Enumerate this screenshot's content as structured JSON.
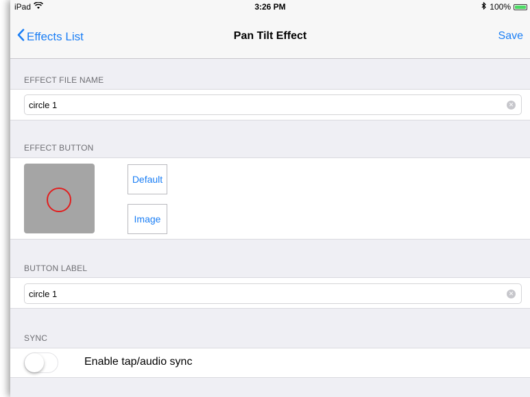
{
  "status_bar": {
    "device": "iPad",
    "time": "3:26 PM",
    "battery": "100%",
    "battery_level": 1.0
  },
  "nav": {
    "back_label": "Effects List",
    "title": "Pan Tilt Effect",
    "save_label": "Save"
  },
  "sections": {
    "file_name": {
      "header": "EFFECT FILE NAME",
      "value": "circle 1"
    },
    "effect_button": {
      "header": "EFFECT BUTTON",
      "default_label": "Default",
      "image_label": "Image"
    },
    "button_label": {
      "header": "BUTTON LABEL",
      "value": "circle 1"
    },
    "sync": {
      "header": "SYNC",
      "toggle_label": "Enable tap/audio sync",
      "enabled": false
    }
  },
  "colors": {
    "accent": "#1a7ef5",
    "background": "#efeff4",
    "preview_bg": "#a5a5a5",
    "preview_ring": "#e21d1d",
    "battery_fill": "#4cd964"
  },
  "icons": {
    "wifi": "wifi-icon",
    "bluetooth": "bluetooth-icon",
    "back": "chevron-left-icon",
    "clear": "clear-circle-icon"
  }
}
